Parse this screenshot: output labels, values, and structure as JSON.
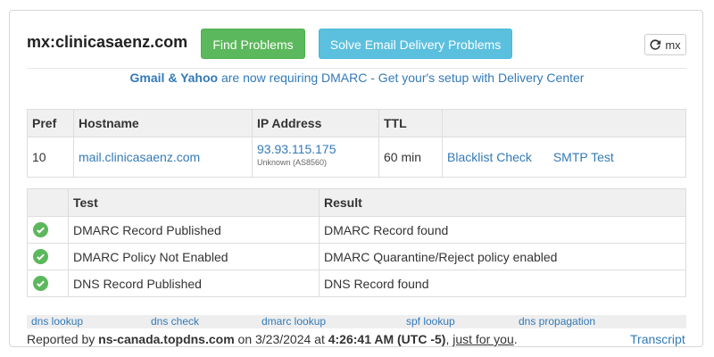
{
  "header": {
    "title": "mx:clinicasaenz.com",
    "find_problems": "Find Problems",
    "solve_email": "Solve Email Delivery Problems",
    "mx_label": "mx"
  },
  "banner": {
    "brand": "Gmail & Yahoo",
    "text": " are now requiring DMARC - Get your's setup with Delivery Center"
  },
  "mx_table": {
    "headers": [
      "Pref",
      "Hostname",
      "IP Address",
      "TTL",
      ""
    ],
    "row": {
      "pref": "10",
      "hostname": "mail.clinicasaenz.com",
      "ip": "93.93.115.175",
      "ip_owner": "Unknown (AS8560)",
      "ttl": "60 min",
      "blacklist": "Blacklist Check",
      "smtp": "SMTP Test"
    }
  },
  "test_table": {
    "headers": [
      "",
      "Test",
      "Result"
    ],
    "rows": [
      {
        "test": "DMARC Record Published",
        "result": "DMARC Record found"
      },
      {
        "test": "DMARC Policy Not Enabled",
        "result": "DMARC Quarantine/Reject policy enabled"
      },
      {
        "test": "DNS Record Published",
        "result": "DNS Record found"
      }
    ]
  },
  "footer_links": [
    "dns lookup",
    "dns check",
    "dmarc lookup",
    "spf lookup",
    "dns propagation"
  ],
  "report": {
    "prefix": "Reported by ",
    "server": "ns-canada.topdns.com",
    "on": " on 3/23/2024 at ",
    "time": "4:26:41 AM (UTC -5)",
    "comma": ", ",
    "just_for_you": "just for you",
    "period": "."
  },
  "transcript": "Transcript",
  "colors": {
    "green": "#5cb85c",
    "blue": "#5bc0de",
    "link": "#337ab7"
  }
}
